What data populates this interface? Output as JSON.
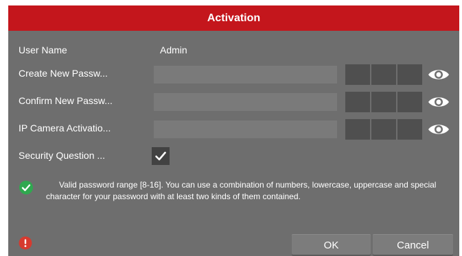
{
  "dialog": {
    "title": "Activation",
    "user_name_label": "User Name",
    "user_name_value": "Admin",
    "create_password_label": "Create New Passw...",
    "confirm_password_label": "Confirm New Passw...",
    "ip_camera_label": "IP Camera Activatio...",
    "security_question_label": "Security Question ...",
    "security_question_checked": true,
    "password_hint": "Valid password range [8-16]. You can use a combination of numbers, lowercase, uppercase and special character for your password with at least two kinds of them contained.",
    "ok_label": "OK",
    "cancel_label": "Cancel"
  },
  "colors": {
    "title_bar": "#c4161c",
    "panel": "#6e6e6e",
    "success_icon": "#2fa84f",
    "error_icon": "#d63a2f"
  },
  "icons": {
    "eye": "eye-icon",
    "check": "checkmark-icon",
    "success": "success-check-icon",
    "error": "error-exclamation-icon"
  }
}
